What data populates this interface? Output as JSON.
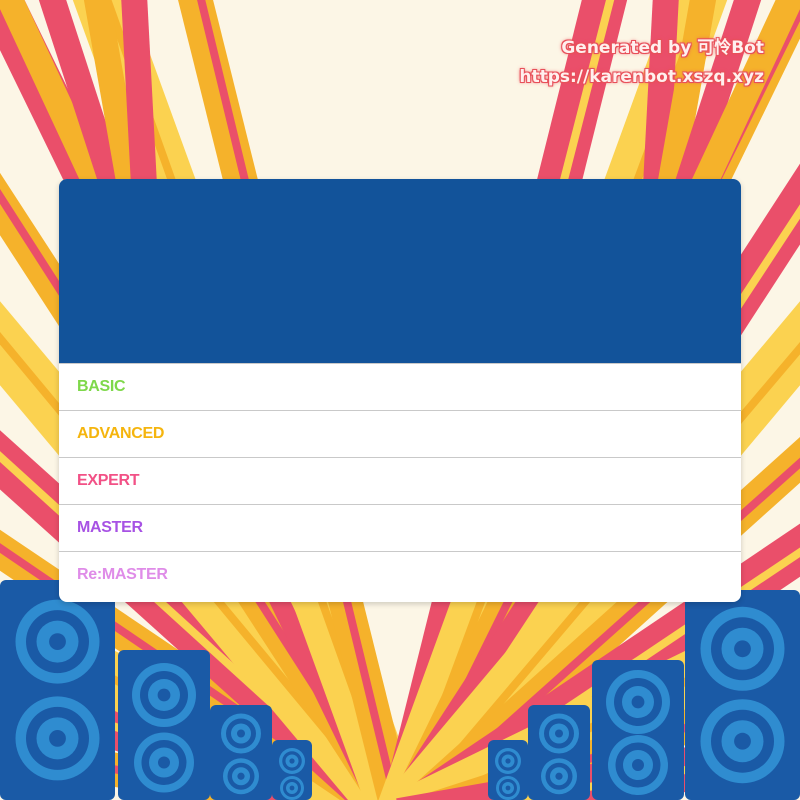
{
  "credit": {
    "line1": "Generated by 可怜Bot",
    "line2": "https://karenbot.xszq.xyz"
  },
  "card": {
    "header_color": "#12539a",
    "difficulties": [
      {
        "label": "BASIC",
        "color": "#7ed84a"
      },
      {
        "label": "ADVANCED",
        "color": "#f5b50e"
      },
      {
        "label": "EXPERT",
        "color": "#f25186"
      },
      {
        "label": "MASTER",
        "color": "#a752e4"
      },
      {
        "label": "Re:MASTER",
        "color": "#df8ce8"
      }
    ]
  },
  "background": {
    "base_color": "#fcf6e6",
    "ray_colors": [
      "#f5b22b",
      "#ea4f6a",
      "#fbd250"
    ],
    "speaker_color": "#1a5aa6",
    "speaker_cone_color": "#2f8cd0"
  }
}
